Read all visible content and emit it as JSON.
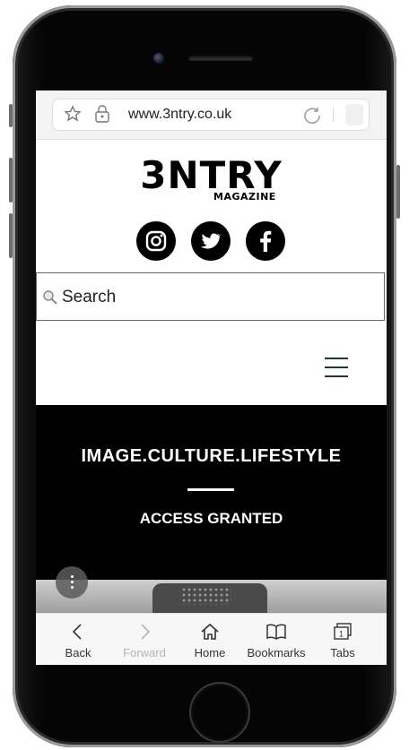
{
  "browser": {
    "url": "www.3ntry.co.uk"
  },
  "site": {
    "logo_main": "3NTRY",
    "logo_sub": "MAGAZINE",
    "social": [
      "instagram-icon",
      "twitter-icon",
      "facebook-icon"
    ],
    "search_placeholder": "Search",
    "hero_title": "IMAGE.CULTURE.LIFESTYLE",
    "hero_subtitle": "ACCESS GRANTED"
  },
  "toolbar": {
    "items": [
      {
        "label": "Back",
        "icon": "back-icon",
        "enabled": true
      },
      {
        "label": "Forward",
        "icon": "forward-icon",
        "enabled": false
      },
      {
        "label": "Home",
        "icon": "home-icon",
        "enabled": true
      },
      {
        "label": "Bookmarks",
        "icon": "bookmarks-icon",
        "enabled": true
      },
      {
        "label": "Tabs",
        "icon": "tabs-icon",
        "enabled": true,
        "count": "1"
      }
    ]
  },
  "colors": {
    "hero_bg": "#000000",
    "menu_icon": "#1f3a32",
    "toolbar_bg": "#f7f7f7"
  }
}
